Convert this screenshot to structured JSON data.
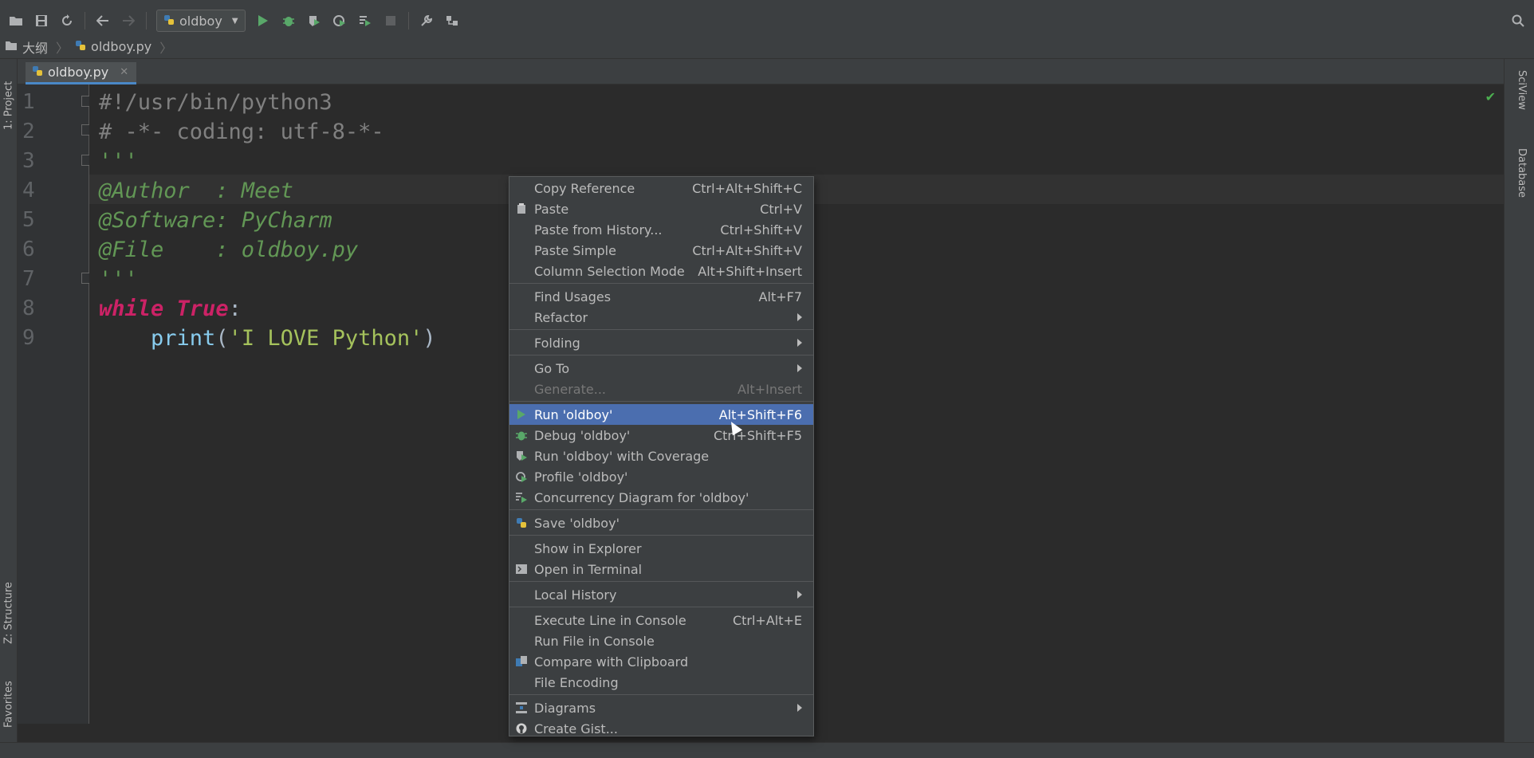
{
  "toolbar": {
    "run_config": "oldboy"
  },
  "breadcrumb": {
    "project": "大纲",
    "file": "oldboy.py"
  },
  "side_tabs": {
    "project": "1: Project",
    "structure": "Z: Structure",
    "favorites": "Favorites",
    "sciview": "SciView",
    "database": "Database"
  },
  "editor": {
    "tab_label": "oldboy.py",
    "line_numbers": [
      "1",
      "2",
      "3",
      "4",
      "5",
      "6",
      "7",
      "8",
      "9"
    ],
    "code": {
      "l1": "#!/usr/bin/python3",
      "l2": "# -*- coding: utf-8-*-",
      "l3": "'''",
      "l4": "@Author  : Meet",
      "l5": "@Software: PyCharm",
      "l6": "@File    : oldboy.py",
      "l7": "'''",
      "l8_kw": "while",
      "l8_true": "True",
      "l8_colon": ":",
      "l9_indent": "    ",
      "l9_fn": "print",
      "l9_open": "(",
      "l9_str": "'I LOVE Python'",
      "l9_close": ")"
    }
  },
  "context_menu": {
    "items": [
      {
        "label": "Copy Reference",
        "shortcut": "Ctrl+Alt+Shift+C"
      },
      {
        "label": "Paste",
        "shortcut": "Ctrl+V"
      },
      {
        "label": "Paste from History...",
        "shortcut": "Ctrl+Shift+V"
      },
      {
        "label": "Paste Simple",
        "shortcut": "Ctrl+Alt+Shift+V"
      },
      {
        "label": "Column Selection Mode",
        "shortcut": "Alt+Shift+Insert"
      },
      {
        "label": "Find Usages",
        "shortcut": "Alt+F7"
      },
      {
        "label": "Refactor",
        "shortcut": ""
      },
      {
        "label": "Folding",
        "shortcut": ""
      },
      {
        "label": "Go To",
        "shortcut": ""
      },
      {
        "label": "Generate...",
        "shortcut": "Alt+Insert"
      },
      {
        "label": "Run 'oldboy'",
        "shortcut": "Alt+Shift+F6"
      },
      {
        "label": "Debug 'oldboy'",
        "shortcut": "Ctrl+Shift+F5"
      },
      {
        "label": "Run 'oldboy' with Coverage",
        "shortcut": ""
      },
      {
        "label": "Profile 'oldboy'",
        "shortcut": ""
      },
      {
        "label": "Concurrency Diagram for 'oldboy'",
        "shortcut": ""
      },
      {
        "label": "Save 'oldboy'",
        "shortcut": ""
      },
      {
        "label": "Show in Explorer",
        "shortcut": ""
      },
      {
        "label": "Open in Terminal",
        "shortcut": ""
      },
      {
        "label": "Local History",
        "shortcut": ""
      },
      {
        "label": "Execute Line in Console",
        "shortcut": "Ctrl+Alt+E"
      },
      {
        "label": "Run File in Console",
        "shortcut": ""
      },
      {
        "label": "Compare with Clipboard",
        "shortcut": ""
      },
      {
        "label": "File Encoding",
        "shortcut": ""
      },
      {
        "label": "Diagrams",
        "shortcut": ""
      },
      {
        "label": "Create Gist...",
        "shortcut": ""
      }
    ]
  },
  "colors": {
    "selection": "#4b6eaf",
    "keyword": "#cc2266",
    "docstring": "#629755",
    "string": "#a5c25c",
    "run_green": "#4caf50"
  }
}
